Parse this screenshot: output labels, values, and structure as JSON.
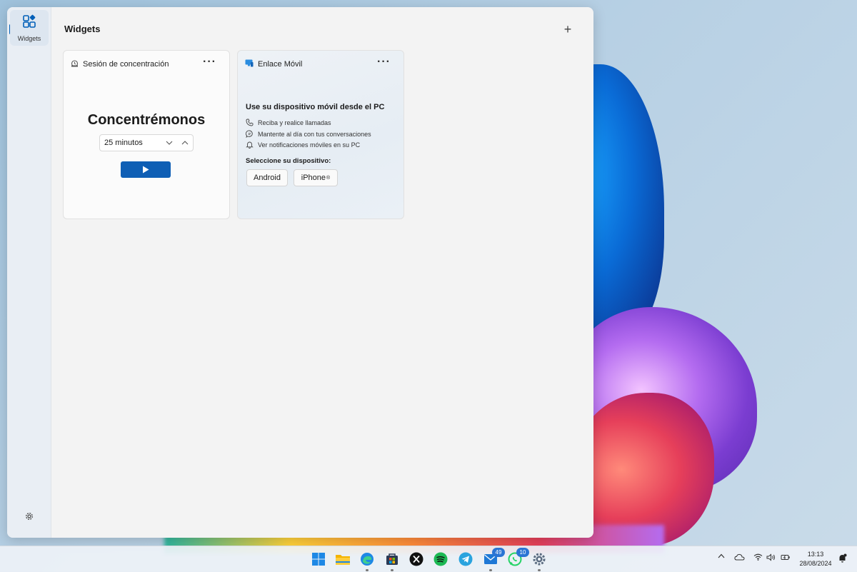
{
  "panel": {
    "title": "Widgets",
    "rail": {
      "widgets_label": "Widgets"
    }
  },
  "focus_widget": {
    "title": "Sesión de concentración",
    "heading": "Concentrémonos",
    "duration_value": "25 minutos"
  },
  "phone_widget": {
    "title": "Enlace Móvil",
    "heading": "Use su dispositivo móvil desde el PC",
    "features": [
      {
        "icon": "phone-icon",
        "text": "Reciba y realice llamadas"
      },
      {
        "icon": "chat-icon",
        "text": "Mantente al día con tus conversaciones"
      },
      {
        "icon": "bell-icon",
        "text": "Ver notificaciones móviles en su PC"
      }
    ],
    "select_label": "Seleccione su dispositivo:",
    "buttons": {
      "android": "Android",
      "iphone": "iPhone",
      "iphone_mark": "®"
    }
  },
  "taskbar": {
    "apps": [
      {
        "name": "start-icon"
      },
      {
        "name": "file-explorer-icon"
      },
      {
        "name": "edge-icon"
      },
      {
        "name": "store-icon"
      },
      {
        "name": "x-icon"
      },
      {
        "name": "spotify-icon"
      },
      {
        "name": "telegram-icon"
      },
      {
        "name": "mail-icon",
        "badge": "49"
      },
      {
        "name": "whatsapp-icon",
        "badge": "10"
      },
      {
        "name": "settings-icon"
      }
    ],
    "clock": {
      "time": "13:13",
      "date": "28/08/2024"
    }
  },
  "colors": {
    "accent": "#005fb8",
    "play_button": "#0f5fb5",
    "badge": "#2a74d4"
  }
}
